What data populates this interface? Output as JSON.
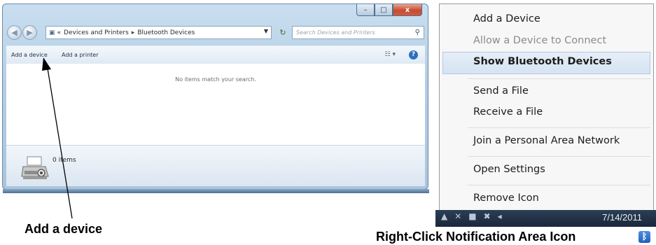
{
  "window": {
    "controls": {
      "minimize": "–",
      "maximize": "□",
      "close": "x"
    },
    "breadcrumb": {
      "overflow": "«",
      "items": [
        "Devices and Printers",
        "Bluetooth Devices"
      ],
      "separator": "▸"
    },
    "search_placeholder": "Search Devices and Printers",
    "toolbar": {
      "add_device": "Add a device",
      "add_printer": "Add a printer"
    },
    "empty_message": "No items match your search.",
    "details": {
      "item_count": "0 items"
    }
  },
  "callouts": {
    "add_device": "Add a device",
    "right_click": "Right-Click Notification Area Icon"
  },
  "context_menu": {
    "items": [
      {
        "label": "Add a Device",
        "state": "normal"
      },
      {
        "label": "Allow a Device to Connect",
        "state": "disabled"
      },
      {
        "label": "Show Bluetooth Devices",
        "state": "default-highlighted"
      },
      {
        "label": "Send a File",
        "state": "normal"
      },
      {
        "label": "Receive a File",
        "state": "normal"
      },
      {
        "label": "Join a Personal Area Network",
        "state": "normal"
      },
      {
        "label": "Open Settings",
        "state": "normal"
      },
      {
        "label": "Remove Icon",
        "state": "normal"
      }
    ]
  },
  "taskbar": {
    "date": "7/14/2011"
  },
  "icons": [
    "back-icon",
    "forward-icon",
    "devices-folder-icon",
    "refresh-icon",
    "search-icon",
    "view-icon",
    "help-icon",
    "printer-icon",
    "bluetooth-icon"
  ],
  "colors": {
    "highlight": "#d6e3f2",
    "close_button": "#c74a2f",
    "bluetooth": "#1e5fbd"
  }
}
